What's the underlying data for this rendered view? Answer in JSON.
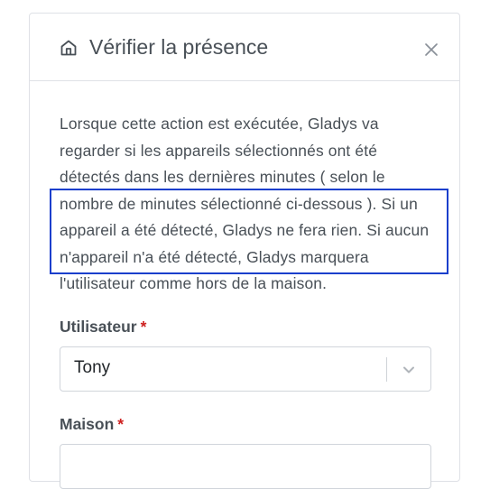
{
  "header": {
    "icon": "home-icon",
    "title": "Vérifier la présence",
    "close_icon": "close-icon"
  },
  "description": "Lorsque cette action est exécutée, Gladys va regarder si les appareils sélectionnés ont été détectés dans les dernières minutes ( selon le nombre de minutes sélectionné ci-dessous ). Si un appareil a été détecté, Gladys ne fera rien. Si aucun n'appareil n'a été détecté, Gladys marquera l'utilisateur comme hors de la maison.",
  "fields": {
    "user": {
      "label": "Utilisateur",
      "required_mark": "*",
      "value": "Tony"
    },
    "house": {
      "label": "Maison",
      "required_mark": "*"
    }
  },
  "colors": {
    "highlight_border": "#1a3fcc",
    "required": "#cd201f",
    "text": "#495057"
  }
}
